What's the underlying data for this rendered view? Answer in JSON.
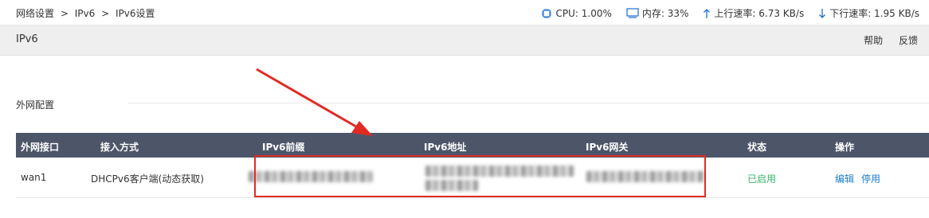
{
  "breadcrumb": {
    "items": [
      "网络设置",
      "IPv6",
      "IPv6设置"
    ],
    "separator": ">"
  },
  "stats": {
    "cpu": "CPU: 1.00%",
    "memory": "内存: 33%",
    "upload": "上行速率: 6.73 KB/s",
    "download": "下行速率: 1.95 KB/s"
  },
  "titlebar": {
    "title": "IPv6",
    "help": "帮助",
    "feedback": "反馈"
  },
  "section": {
    "label": "外网配置"
  },
  "table": {
    "headers": [
      "外网接口",
      "接入方式",
      "IPv6前缀",
      "IPv6地址",
      "IPv6网关",
      "状态",
      "操作"
    ],
    "rows": [
      {
        "interface": "wan1",
        "method": "DHCPv6客户端(动态获取)",
        "status": "已启用",
        "actions": [
          "编辑",
          "停用"
        ]
      }
    ]
  },
  "colors": {
    "header_bg": "#4d5669",
    "status_green": "#37b36b",
    "link_blue": "#1b7cc7",
    "annotation_red": "#e02b24"
  },
  "icons": [
    "cpu-icon",
    "memory-icon",
    "arrow-up-icon",
    "arrow-down-icon"
  ]
}
